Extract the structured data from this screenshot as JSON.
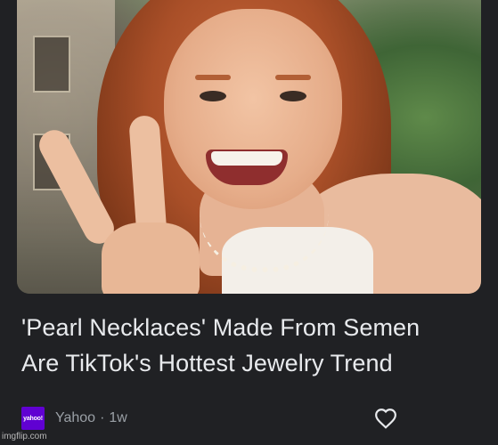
{
  "headline": {
    "line1": "'Pearl Necklaces' Made From Semen",
    "line2": "Are TikTok's Hottest Jewelry Trend"
  },
  "source": {
    "logo_text": "yahoo!",
    "name": "Yahoo",
    "separator": "·",
    "age": "1w"
  },
  "actions": {
    "like_icon": "heart-outline-icon"
  },
  "watermark": "imgflip.com",
  "colors": {
    "background": "#202124",
    "headline_text": "#e8eaed",
    "meta_text": "#9aa0a6",
    "yahoo_purple": "#6001d2"
  }
}
